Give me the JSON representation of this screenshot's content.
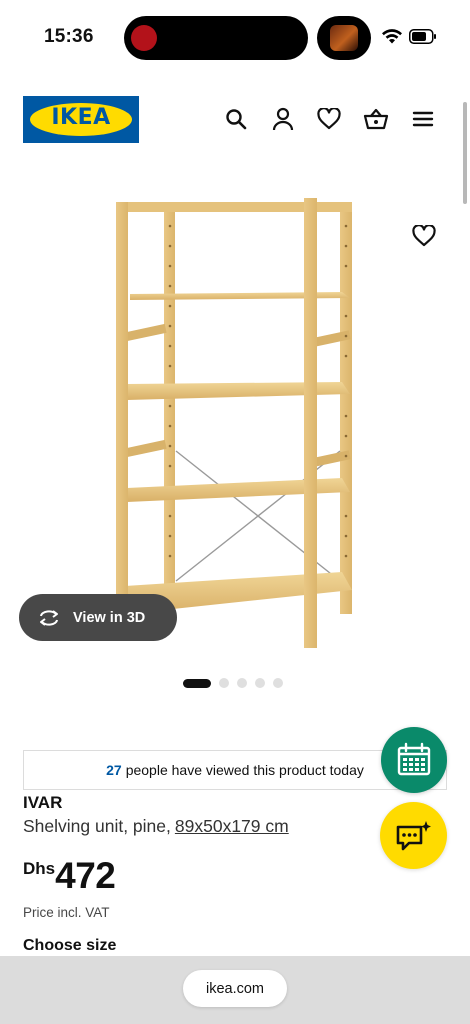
{
  "status_bar": {
    "time": "15:36",
    "icons": [
      "wifi-icon",
      "battery-icon"
    ]
  },
  "header": {
    "logo_text": "IKEA",
    "icons": [
      "search-icon",
      "account-icon",
      "heart-icon",
      "basket-icon",
      "menu-icon"
    ],
    "colors": {
      "brand_blue": "#0058a3",
      "brand_yellow": "#ffdb00"
    }
  },
  "gallery": {
    "view_3d_label": "View in 3D",
    "image_count": 5,
    "active_index": 0
  },
  "views_banner": {
    "count": "27",
    "text": "people have viewed this product today"
  },
  "product": {
    "name": "IVAR",
    "description": "Shelving unit, pine,",
    "dimensions": "89x50x179 cm",
    "currency": "Dhs",
    "price": "472",
    "price_note": "Price incl. VAT",
    "choose_size_label": "Choose size"
  },
  "floating": {
    "calendar_color": "#0a8a6a",
    "chat_color": "#ffdb00"
  },
  "browser": {
    "url": "ikea.com"
  }
}
